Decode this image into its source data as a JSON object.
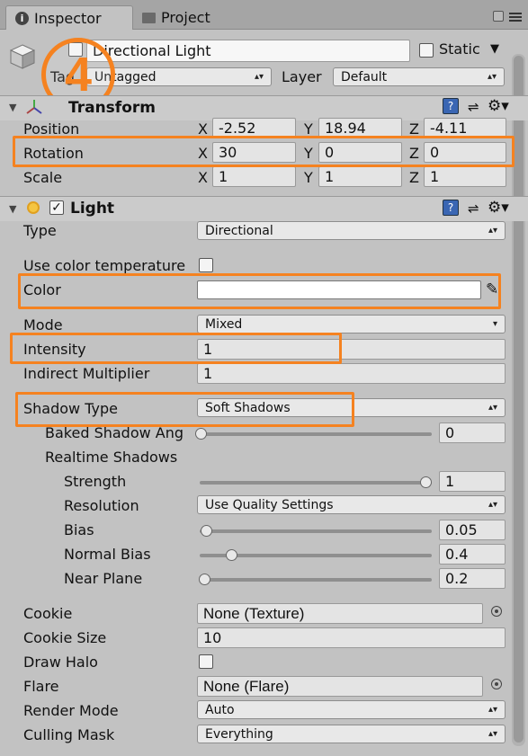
{
  "tabs": [
    {
      "label": "Inspector"
    },
    {
      "label": "Project"
    }
  ],
  "object": {
    "name": "Directional Light",
    "static_label": "Static",
    "tag_label": "Tag",
    "tag_value": "Untagged",
    "layer_label": "Layer",
    "layer_value": "Default",
    "step_badge": "4"
  },
  "transform": {
    "title": "Transform",
    "rows": [
      {
        "label": "Position",
        "x": "-2.52",
        "y": "18.94",
        "z": "-4.11"
      },
      {
        "label": "Rotation",
        "x": "30",
        "y": "0",
        "z": "0"
      },
      {
        "label": "Scale",
        "x": "1",
        "y": "1",
        "z": "1"
      }
    ],
    "axis": {
      "x": "X",
      "y": "Y",
      "z": "Z"
    }
  },
  "light": {
    "title": "Light",
    "type_label": "Type",
    "type_value": "Directional",
    "use_color_temp_label": "Use color temperature",
    "color_label": "Color",
    "color_value": "#ffffff",
    "mode_label": "Mode",
    "mode_value": "Mixed",
    "intensity_label": "Intensity",
    "intensity_value": "1",
    "indirect_label": "Indirect Multiplier",
    "indirect_value": "1",
    "shadow_type_label": "Shadow Type",
    "shadow_type_value": "Soft Shadows",
    "baked_angle_label": "Baked Shadow Ang",
    "baked_angle_value": "0",
    "baked_angle_level": 0,
    "realtime_label": "Realtime Shadows",
    "strength_label": "Strength",
    "strength_value": "1",
    "strength_level": 1,
    "resolution_label": "Resolution",
    "resolution_value": "Use Quality Settings",
    "bias_label": "Bias",
    "bias_value": "0.05",
    "bias_level": 0.025,
    "normal_bias_label": "Normal Bias",
    "normal_bias_value": "0.4",
    "normal_bias_level": 0.133,
    "near_plane_label": "Near Plane",
    "near_plane_value": "0.2",
    "near_plane_level": 0.02,
    "cookie_label": "Cookie",
    "cookie_value": "None (Texture)",
    "cookie_size_label": "Cookie Size",
    "cookie_size_value": "10",
    "draw_halo_label": "Draw Halo",
    "flare_label": "Flare",
    "flare_value": "None (Flare)",
    "render_mode_label": "Render Mode",
    "render_mode_value": "Auto",
    "culling_label": "Culling Mask",
    "culling_value": "Everything"
  },
  "colors": {
    "highlight": "#f58220",
    "panel": "#c2c2c2"
  },
  "icons": [
    "info-icon",
    "folder-icon",
    "lock-icon",
    "menu-icon",
    "cube-icon",
    "transform-icon",
    "light-icon",
    "help-icon",
    "preset-icon",
    "settings-gear-icon",
    "eyedropper-icon",
    "object-picker-icon"
  ]
}
